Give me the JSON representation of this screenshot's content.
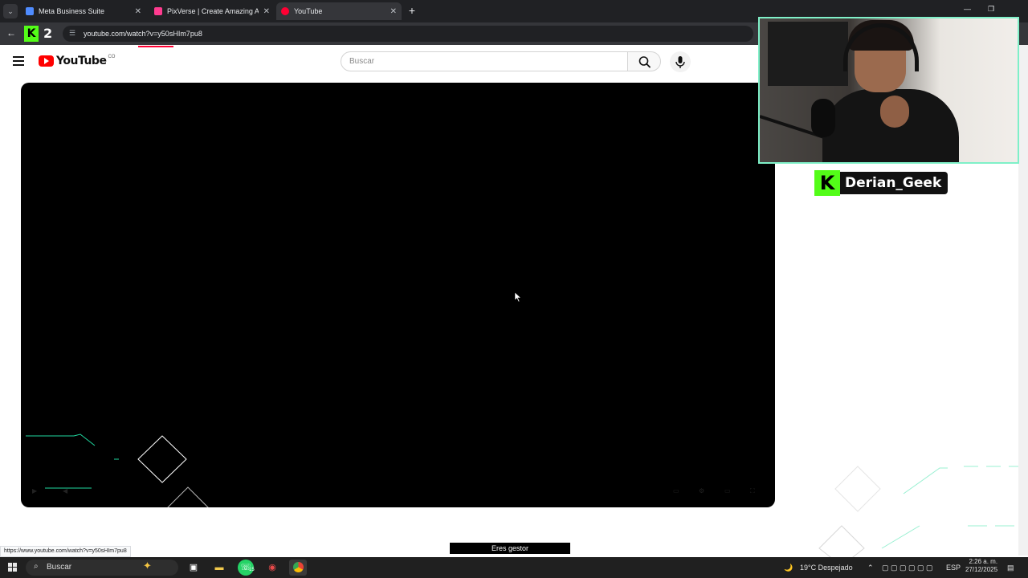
{
  "browser": {
    "tabs": [
      {
        "title": "Meta Business Suite",
        "favicon_color": "#4f8cff"
      },
      {
        "title": "PixVerse | Create Amazing AI V",
        "favicon_color": "#ff3b8f"
      },
      {
        "title": "YouTube",
        "favicon_color": "#ff0033",
        "active": true
      }
    ],
    "address": "youtube.com/watch?v=y50sHIm7pu8",
    "extension_label": "2",
    "status_url": "https://www.youtube.com/watch?v=y50sHIm7pu8"
  },
  "youtube": {
    "logo_text": "YouTube",
    "country_code": "CO",
    "search_placeholder": "Buscar"
  },
  "stream_overlay": {
    "streamer_name": "Derian_Geek",
    "caption": "Eres gestor"
  },
  "taskbar": {
    "search_label": "Buscar",
    "whatsapp_badge": "15",
    "weather": "19°C  Despejado",
    "language": "ESP",
    "time": "2:26 a. m.",
    "date": "27/12/2025"
  },
  "colors": {
    "kick_green": "#53fc18",
    "youtube_red": "#ff0000",
    "cam_border": "#7ff0c8"
  }
}
